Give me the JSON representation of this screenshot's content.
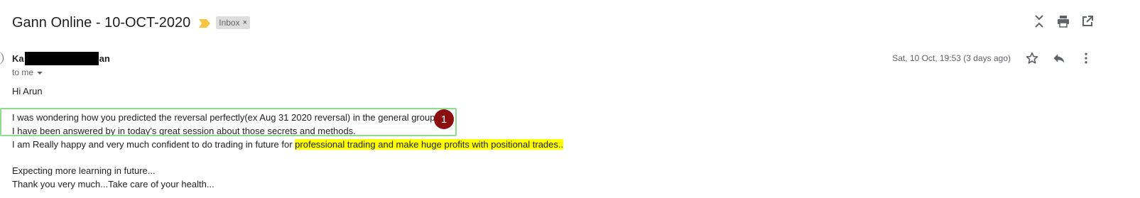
{
  "header": {
    "subject": "Gann Online - 10-OCT-2020",
    "label_chip": "Inbox",
    "label_close": "×",
    "icons": [
      "collapse-all-icon",
      "print-icon",
      "open-in-new-window-icon"
    ]
  },
  "message": {
    "sender_prefix": "Ka",
    "sender_suffix": "an",
    "recipient": "to me",
    "date": "Sat, 10 Oct, 19:53 (3 days ago)",
    "actions": [
      "star-icon",
      "reply-icon",
      "more-icon"
    ]
  },
  "body": {
    "greeting": "Hi Arun",
    "line1": "I was wondering how you predicted the reversal perfectly(ex Aug 31 2020 reversal) in the general group",
    "line2": "I have been answered by in today's great session about those secrets and methods.",
    "line3_plain": "I am Really happy and very much confident to do trading in future for ",
    "line3_highlight": "professional trading and make huge profits with positional trades..",
    "line4": "Expecting more learning in future...",
    "line5": "Thank you very much...Take care of your health..."
  },
  "annotation": {
    "badge": "1",
    "box_color": "#8fdc8f",
    "badge_color": "#8b0f0f",
    "highlight_color": "#ffff00"
  }
}
